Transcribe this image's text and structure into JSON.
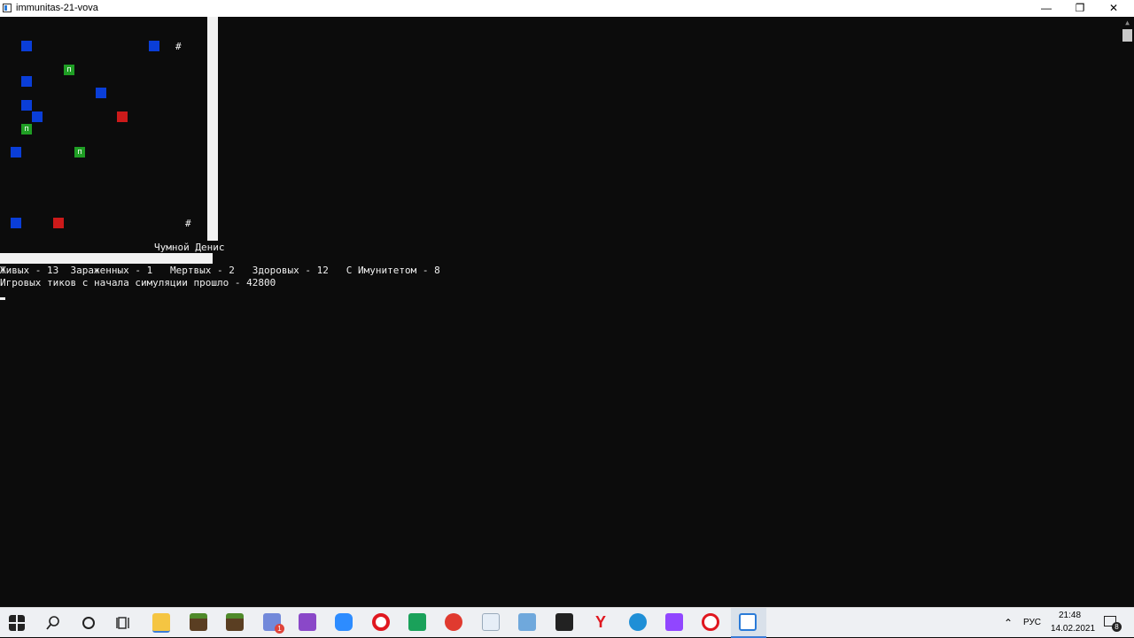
{
  "window": {
    "title": "immunitas-21-vova",
    "minimize": "—",
    "maximize": "❐",
    "close": "✕"
  },
  "grid": {
    "wall_char": "#",
    "green_char": "п",
    "colors": {
      "healthy": "#0a3ed8",
      "infected": "#cc1a1a",
      "immune": "#1f9e24"
    }
  },
  "console": {
    "entity_name": "Чумной Денис",
    "stats_line": "Живых - 13  Зараженных - 1   Мертвых - 2   Здоровых - 12   С Имунитетом - 8",
    "ticks_line": "Игровых тиков с начала симуляции прошло - 42800"
  },
  "taskbar": {
    "icons": [
      "windows-start-icon",
      "search-icon",
      "cortana-icon",
      "task-view-icon",
      "file-explorer-icon",
      "minecraft-icon",
      "minecraft-icon-2",
      "discord-icon",
      "visual-studio-icon",
      "zoom-icon",
      "opera-icon",
      "green-app-icon",
      "rocket-app-icon",
      "notepad-app-icon",
      "paint-app-icon",
      "cat-app-icon",
      "yandex-icon",
      "edge-icon",
      "twitch-icon",
      "opera-gx-icon",
      "console-app-icon"
    ],
    "discord_badge": "1",
    "lang": "РУС",
    "time": "21:48",
    "date": "14.02.2021",
    "notifications_count": "8"
  }
}
